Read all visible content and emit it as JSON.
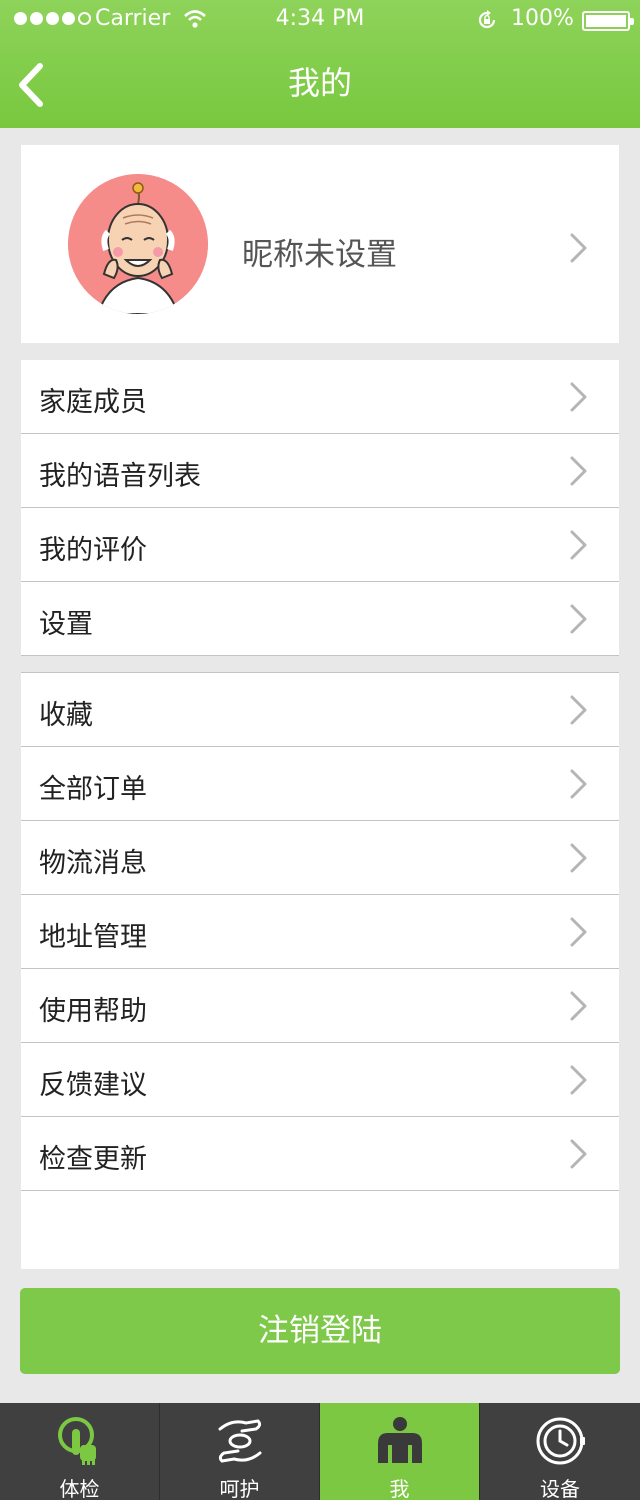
{
  "status_bar": {
    "carrier": "Carrier",
    "time": "4:34 PM",
    "battery": "100%"
  },
  "header": {
    "title": "我的"
  },
  "profile": {
    "nickname": "昵称未设置"
  },
  "menu_group_1": [
    {
      "label": "家庭成员"
    },
    {
      "label": "我的语音列表"
    },
    {
      "label": "我的评价"
    },
    {
      "label": "设置"
    }
  ],
  "menu_group_2": [
    {
      "label": "收藏"
    },
    {
      "label": "全部订单"
    },
    {
      "label": "物流消息"
    },
    {
      "label": "地址管理"
    },
    {
      "label": "使用帮助"
    },
    {
      "label": "反馈建议"
    },
    {
      "label": "检查更新"
    }
  ],
  "logout_label": "注销登陆",
  "tabs": [
    {
      "label": "体检",
      "icon": "checkup-hand-icon"
    },
    {
      "label": "呵护",
      "icon": "care-hands-icon"
    },
    {
      "label": "我",
      "icon": "user-icon",
      "active": true
    },
    {
      "label": "设备",
      "icon": "watch-device-icon"
    }
  ],
  "colors": {
    "brand_green": "#7ec94a",
    "tabbar_dark": "#404040"
  }
}
